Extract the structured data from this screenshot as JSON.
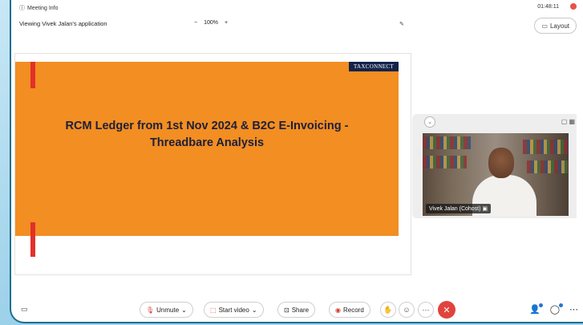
{
  "header": {
    "meeting_info_label": "Meeting Info",
    "clock": "01:48:11",
    "viewing_text": "Viewing Vivek Jalan's application",
    "zoom_minus": "−",
    "zoom_value": "100%",
    "zoom_plus": "+",
    "layout_label": "Layout"
  },
  "slide": {
    "logo_text": "TAXCONNECT",
    "title_line1": "RCM Ledger from 1st Nov 2024 & B2C E-Invoicing -",
    "title_line2": "Threadbare Analysis"
  },
  "participant": {
    "name_tag": "Vivek Jalan (Cohost)"
  },
  "controls": {
    "unmute_label": "Unmute",
    "start_video_label": "Start video",
    "share_label": "Share",
    "record_label": "Record"
  },
  "colors": {
    "slide_orange": "#f28e22",
    "slide_red_accent": "#e3302a",
    "end_call_red": "#e0443c",
    "frame_border": "#1f6e8e"
  }
}
